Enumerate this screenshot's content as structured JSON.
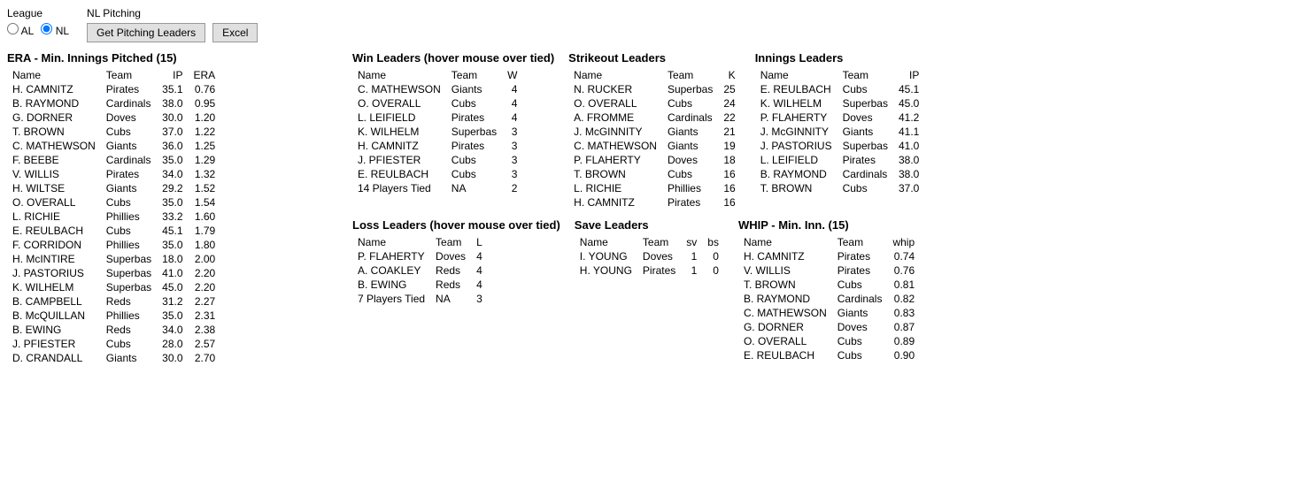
{
  "league": {
    "label": "League",
    "options": [
      "AL",
      "NL"
    ],
    "selected": "NL"
  },
  "pitching": {
    "title": "NL Pitching",
    "button_label": "Get Pitching Leaders",
    "excel_label": "Excel"
  },
  "era": {
    "title": "ERA - Min. Innings Pitched (15)",
    "columns": [
      "Name",
      "Team",
      "IP",
      "ERA"
    ],
    "rows": [
      [
        "H. CAMNITZ",
        "Pirates",
        "35.1",
        "0.76"
      ],
      [
        "B. RAYMOND",
        "Cardinals",
        "38.0",
        "0.95"
      ],
      [
        "G. DORNER",
        "Doves",
        "30.0",
        "1.20"
      ],
      [
        "T. BROWN",
        "Cubs",
        "37.0",
        "1.22"
      ],
      [
        "C. MATHEWSON",
        "Giants",
        "36.0",
        "1.25"
      ],
      [
        "F. BEEBE",
        "Cardinals",
        "35.0",
        "1.29"
      ],
      [
        "V. WILLIS",
        "Pirates",
        "34.0",
        "1.32"
      ],
      [
        "H. WILTSE",
        "Giants",
        "29.2",
        "1.52"
      ],
      [
        "O. OVERALL",
        "Cubs",
        "35.0",
        "1.54"
      ],
      [
        "L. RICHIE",
        "Phillies",
        "33.2",
        "1.60"
      ],
      [
        "E. REULBACH",
        "Cubs",
        "45.1",
        "1.79"
      ],
      [
        "F. CORRIDON",
        "Phillies",
        "35.0",
        "1.80"
      ],
      [
        "H. McINTIRE",
        "Superbas",
        "18.0",
        "2.00"
      ],
      [
        "J. PASTORIUS",
        "Superbas",
        "41.0",
        "2.20"
      ],
      [
        "K. WILHELM",
        "Superbas",
        "45.0",
        "2.20"
      ],
      [
        "B. CAMPBELL",
        "Reds",
        "31.2",
        "2.27"
      ],
      [
        "B. McQUILLAN",
        "Phillies",
        "35.0",
        "2.31"
      ],
      [
        "B. EWING",
        "Reds",
        "34.0",
        "2.38"
      ],
      [
        "J. PFIESTER",
        "Cubs",
        "28.0",
        "2.57"
      ],
      [
        "D. CRANDALL",
        "Giants",
        "30.0",
        "2.70"
      ]
    ]
  },
  "win_leaders": {
    "title": "Win Leaders (hover mouse over tied)",
    "columns": [
      "Name",
      "Team",
      "W"
    ],
    "rows": [
      [
        "C. MATHEWSON",
        "Giants",
        "4"
      ],
      [
        "O. OVERALL",
        "Cubs",
        "4"
      ],
      [
        "L. LEIFIELD",
        "Pirates",
        "4"
      ],
      [
        "K. WILHELM",
        "Superbas",
        "3"
      ],
      [
        "H. CAMNITZ",
        "Pirates",
        "3"
      ],
      [
        "J. PFIESTER",
        "Cubs",
        "3"
      ],
      [
        "E. REULBACH",
        "Cubs",
        "3"
      ],
      [
        "14 Players Tied",
        "NA",
        "2"
      ]
    ]
  },
  "strikeout_leaders": {
    "title": "Strikeout Leaders",
    "columns": [
      "Name",
      "Team",
      "K"
    ],
    "rows": [
      [
        "N. RUCKER",
        "Superbas",
        "25"
      ],
      [
        "O. OVERALL",
        "Cubs",
        "24"
      ],
      [
        "A. FROMME",
        "Cardinals",
        "22"
      ],
      [
        "J. McGINNITY",
        "Giants",
        "21"
      ],
      [
        "C. MATHEWSON",
        "Giants",
        "19"
      ],
      [
        "P. FLAHERTY",
        "Doves",
        "18"
      ],
      [
        "T. BROWN",
        "Cubs",
        "16"
      ],
      [
        "L. RICHIE",
        "Phillies",
        "16"
      ],
      [
        "H. CAMNITZ",
        "Pirates",
        "16"
      ]
    ]
  },
  "innings_leaders": {
    "title": "Innings Leaders",
    "columns": [
      "Name",
      "Team",
      "IP"
    ],
    "rows": [
      [
        "E. REULBACH",
        "Cubs",
        "45.1"
      ],
      [
        "K. WILHELM",
        "Superbas",
        "45.0"
      ],
      [
        "P. FLAHERTY",
        "Doves",
        "41.2"
      ],
      [
        "J. McGINNITY",
        "Giants",
        "41.1"
      ],
      [
        "J. PASTORIUS",
        "Superbas",
        "41.0"
      ],
      [
        "L. LEIFIELD",
        "Pirates",
        "38.0"
      ],
      [
        "B. RAYMOND",
        "Cardinals",
        "38.0"
      ],
      [
        "T. BROWN",
        "Cubs",
        "37.0"
      ]
    ]
  },
  "loss_leaders": {
    "title": "Loss Leaders (hover mouse over tied)",
    "columns": [
      "Name",
      "Team",
      "L"
    ],
    "rows": [
      [
        "P. FLAHERTY",
        "Doves",
        "4"
      ],
      [
        "A. COAKLEY",
        "Reds",
        "4"
      ],
      [
        "B. EWING",
        "Reds",
        "4"
      ],
      [
        "7 Players Tied",
        "NA",
        "3"
      ]
    ]
  },
  "save_leaders": {
    "title": "Save Leaders",
    "columns": [
      "Name",
      "Team",
      "sv",
      "bs"
    ],
    "rows": [
      [
        "I. YOUNG",
        "Doves",
        "1",
        "0"
      ],
      [
        "H. YOUNG",
        "Pirates",
        "1",
        "0"
      ]
    ]
  },
  "whip": {
    "title": "WHIP - Min. Inn. (15)",
    "columns": [
      "Name",
      "Team",
      "whip"
    ],
    "rows": [
      [
        "H. CAMNITZ",
        "Pirates",
        "0.74"
      ],
      [
        "V. WILLIS",
        "Pirates",
        "0.76"
      ],
      [
        "T. BROWN",
        "Cubs",
        "0.81"
      ],
      [
        "B. RAYMOND",
        "Cardinals",
        "0.82"
      ],
      [
        "C. MATHEWSON",
        "Giants",
        "0.83"
      ],
      [
        "G. DORNER",
        "Doves",
        "0.87"
      ],
      [
        "O. OVERALL",
        "Cubs",
        "0.89"
      ],
      [
        "E. REULBACH",
        "Cubs",
        "0.90"
      ]
    ]
  }
}
